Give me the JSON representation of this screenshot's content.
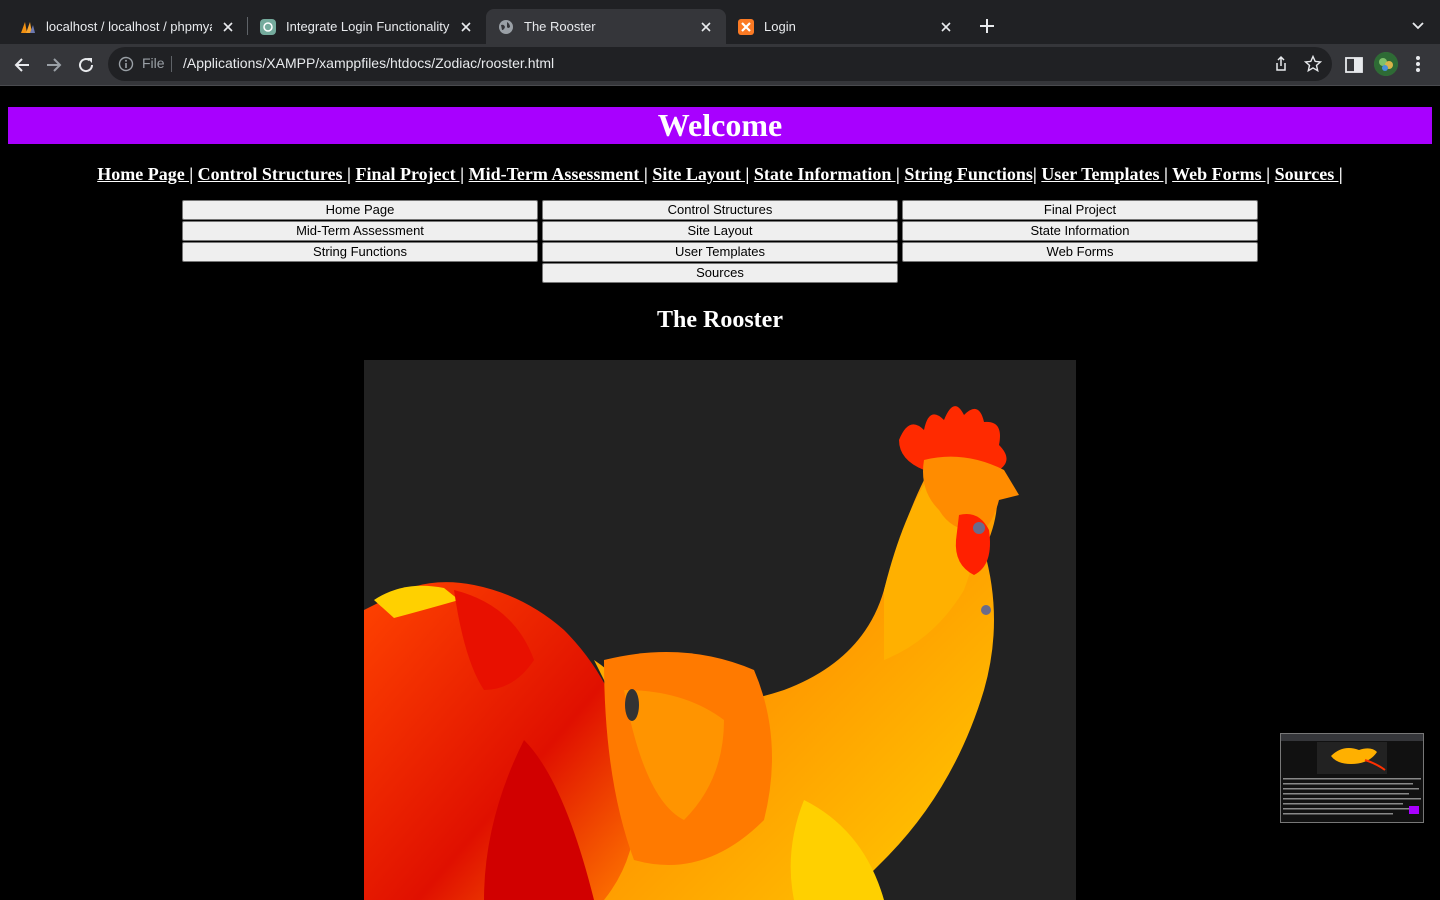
{
  "browser": {
    "tabs": [
      {
        "title": "localhost / localhost / phpmyadmin",
        "icon": "phpmyadmin-icon",
        "active": false
      },
      {
        "title": "Integrate Login Functionality",
        "icon": "chatgpt-icon",
        "active": false
      },
      {
        "title": "The Rooster",
        "icon": "globe-icon",
        "active": true
      },
      {
        "title": "Login",
        "icon": "xampp-icon",
        "active": false
      }
    ],
    "omnibox": {
      "scheme_label": "File",
      "url": "/Applications/XAMPP/xamppfiles/htdocs/Zodiac/rooster.html"
    }
  },
  "page": {
    "banner": "Welcome",
    "nav_links": [
      {
        "label": "Home Page |"
      },
      {
        "label": "Control Structures |"
      },
      {
        "label": "Final Project |"
      },
      {
        "label": "Mid-Term Assessment |"
      },
      {
        "label": "Site Layout |"
      },
      {
        "label": "State Information |"
      },
      {
        "label": "String Functions|"
      },
      {
        "label": "User Templates |"
      },
      {
        "label": "Web Forms |"
      },
      {
        "label": "Sources |"
      }
    ],
    "nav_buttons": [
      "Home Page",
      "Control Structures",
      "Final Project",
      "Mid-Term Assessment",
      "Site Layout",
      "State Information",
      "String Functions",
      "User Templates",
      "Web Forms",
      "Sources"
    ],
    "title": "The Rooster",
    "colors": {
      "banner_bg": "#a800ff",
      "page_bg": "#000000",
      "text": "#ffffff"
    }
  }
}
